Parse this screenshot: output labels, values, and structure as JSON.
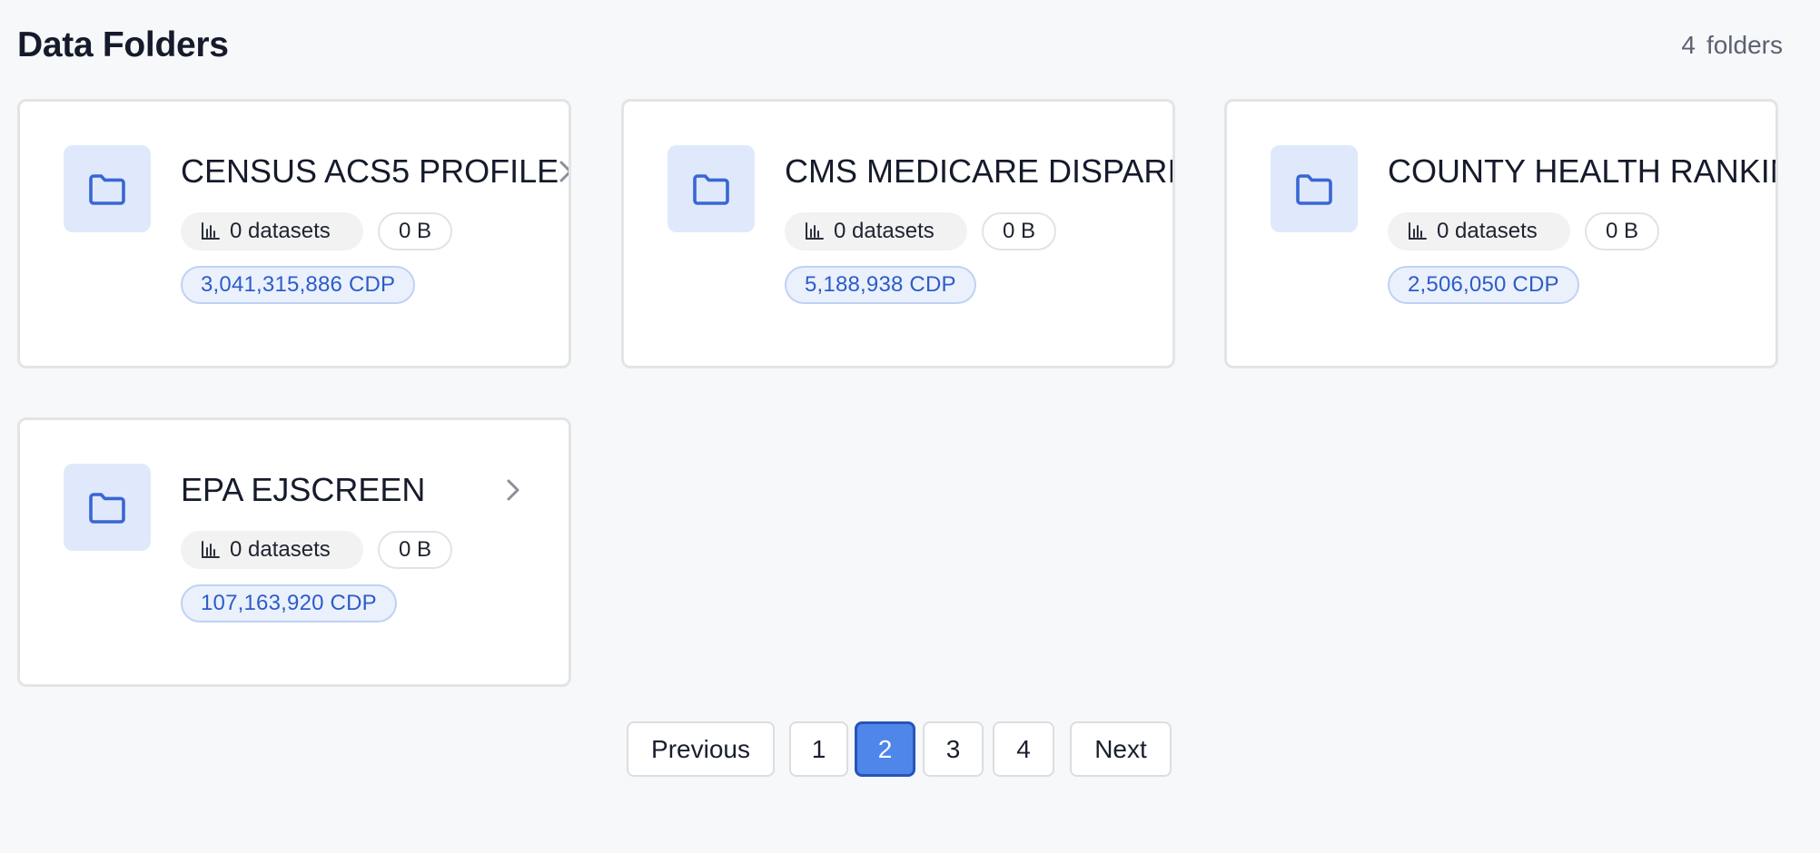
{
  "header": {
    "title": "Data Folders",
    "count_number": "4",
    "count_label": "folders"
  },
  "folders": [
    {
      "name": "CENSUS ACS5 PROFILE",
      "datasets": "0 datasets",
      "size": "0 B",
      "cdp": "3,041,315,886 CDP"
    },
    {
      "name": "CMS MEDICARE DISPARITIES",
      "datasets": "0 datasets",
      "size": "0 B",
      "cdp": "5,188,938 CDP"
    },
    {
      "name": "COUNTY HEALTH RANKINGS",
      "datasets": "0 datasets",
      "size": "0 B",
      "cdp": "2,506,050 CDP"
    },
    {
      "name": "EPA EJSCREEN",
      "datasets": "0 datasets",
      "size": "0 B",
      "cdp": "107,163,920 CDP"
    }
  ],
  "pagination": {
    "previous_label": "Previous",
    "pages": [
      "1",
      "2",
      "3",
      "4"
    ],
    "current_page": "2",
    "next_label": "Next"
  },
  "colors": {
    "accent": "#4f86ea",
    "folder_icon": "#3a66d4",
    "folder_tile": "#dfe9fb",
    "cdp_text": "#2e5cc7"
  },
  "icons": {
    "folder": "folder-icon",
    "datasets": "bar-chart-icon",
    "open": "chevron-right-icon"
  }
}
